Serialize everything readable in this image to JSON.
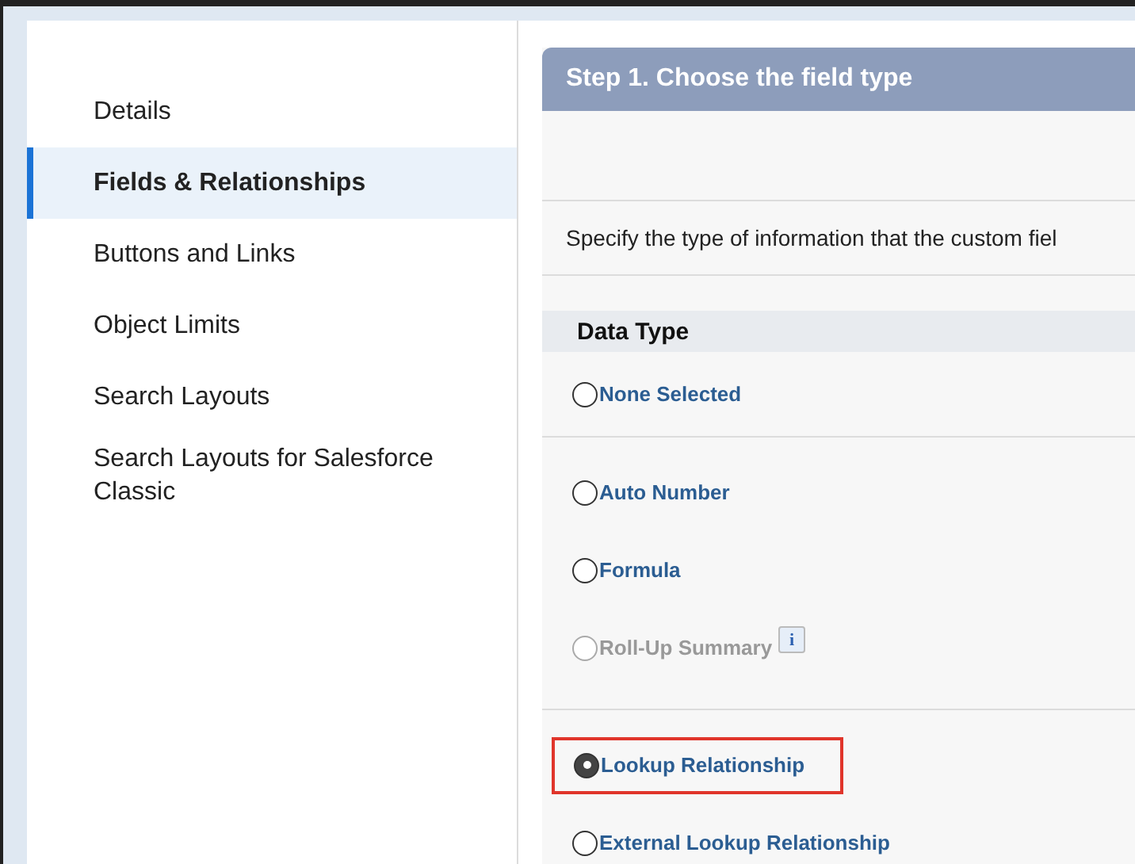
{
  "sidebar": {
    "items": [
      {
        "label": "Details",
        "selected": false
      },
      {
        "label": "Fields & Relationships",
        "selected": true
      },
      {
        "label": "Buttons and Links",
        "selected": false
      },
      {
        "label": "Object Limits",
        "selected": false
      },
      {
        "label": "Search Layouts",
        "selected": false
      },
      {
        "label": "Search Layouts for Salesforce Classic",
        "selected": false
      }
    ]
  },
  "panel": {
    "title": "Step 1. Choose the field type",
    "description": "Specify the type of information that the custom fiel",
    "data_type_header": "Data Type",
    "option_groups": [
      {
        "options": [
          {
            "label": "None Selected",
            "selected": false,
            "disabled": false,
            "highlighted": false
          }
        ]
      },
      {
        "options": [
          {
            "label": "Auto Number",
            "selected": false,
            "disabled": false,
            "highlighted": false
          },
          {
            "label": "Formula",
            "selected": false,
            "disabled": false,
            "highlighted": false
          },
          {
            "label": "Roll-Up Summary",
            "selected": false,
            "disabled": true,
            "highlighted": false,
            "info_badge": "i"
          }
        ]
      },
      {
        "options": [
          {
            "label": "Lookup Relationship",
            "selected": true,
            "disabled": false,
            "highlighted": true
          },
          {
            "label": "External Lookup Relationship",
            "selected": false,
            "disabled": false,
            "highlighted": false
          }
        ]
      }
    ]
  }
}
